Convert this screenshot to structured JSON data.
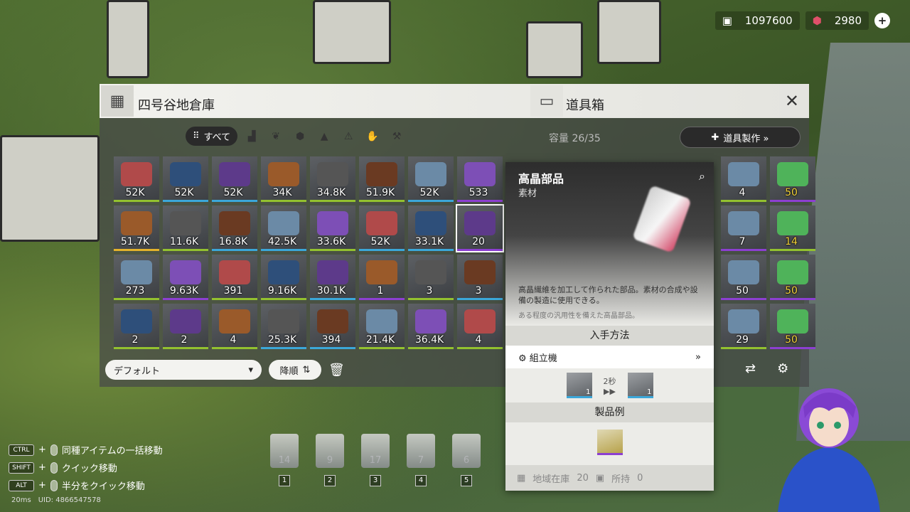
{
  "hud": {
    "currency1_value": "1097600",
    "currency2_value": "2980",
    "add_label": "+"
  },
  "left_panel": {
    "title": "四号谷地倉庫"
  },
  "right_panel": {
    "title": "道具箱",
    "capacity": "容量 26/35",
    "craft_label": "道具製作 »"
  },
  "filters": {
    "all_label": "すべて"
  },
  "grid_rows": [
    [
      "52K",
      "52K",
      "52K",
      "34K",
      "34.8K",
      "51.9K",
      "52K",
      "533"
    ],
    [
      "51.7K",
      "11.6K",
      "16.8K",
      "42.5K",
      "33.6K",
      "52K",
      "33.1K",
      "20"
    ],
    [
      "273",
      "9.63K",
      "391",
      "9.16K",
      "30.1K",
      "1",
      "3",
      "3"
    ],
    [
      "2",
      "2",
      "4",
      "25.3K",
      "394",
      "21.4K",
      "36.4K",
      "4"
    ]
  ],
  "cell_borders": [
    [
      "g",
      "b",
      "b",
      "g",
      "g",
      "g",
      "b",
      "p"
    ],
    [
      "y",
      "g",
      "b",
      "b",
      "g",
      "b",
      "b",
      "p"
    ],
    [
      "g",
      "p",
      "g",
      "g",
      "b",
      "p",
      "g",
      "b"
    ],
    [
      "g",
      "g",
      "g",
      "b",
      "b",
      "g",
      "g",
      "g"
    ]
  ],
  "bottom": {
    "sort_label": "デフォルト",
    "order_label": "降順"
  },
  "tooltip": {
    "name": "高晶部品",
    "category": "素材",
    "desc1": "高晶繊維を加工して作られた部品。素材の合成や設備の製造に使用できる。",
    "desc2": "ある程度の汎用性を備えた高晶部品。",
    "obtain_header": "入手方法",
    "method": "組立機",
    "time": "2秒",
    "in_count": "1",
    "out_count": "1",
    "product_header": "製品例",
    "stock_label": "地域在庫",
    "stock_value": "20",
    "held_label": "所持",
    "held_value": "0"
  },
  "right_counts": [
    "4",
    "50",
    "7",
    "14",
    "50",
    "50",
    "29",
    "50"
  ],
  "hotbar": [
    {
      "count": "14",
      "slot": "1"
    },
    {
      "count": "9",
      "slot": "2"
    },
    {
      "count": "17",
      "slot": "3"
    },
    {
      "count": "7",
      "slot": "4"
    },
    {
      "count": "6",
      "slot": "5"
    }
  ],
  "keys": [
    {
      "key": "CTRL",
      "label": "同種アイテムの一括移動"
    },
    {
      "key": "SHIFT",
      "label": "クイック移動"
    },
    {
      "key": "ALT",
      "label": "半分をクイック移動"
    }
  ],
  "meta": {
    "ping": "20ms",
    "uid": "UID: 4866547578"
  }
}
